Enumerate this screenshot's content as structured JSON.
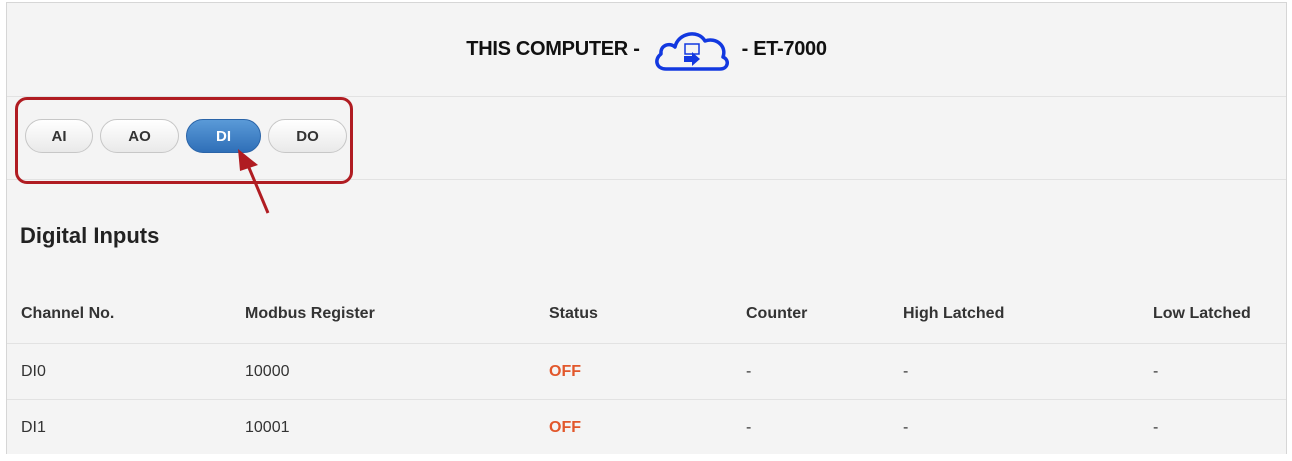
{
  "header": {
    "left_text": "THIS COMPUTER -",
    "right_text": "- ET-7000",
    "icon": "cloud-sync-icon"
  },
  "tabs": [
    {
      "label": "AI",
      "active": false
    },
    {
      "label": "AO",
      "active": false
    },
    {
      "label": "DI",
      "active": true
    },
    {
      "label": "DO",
      "active": false
    }
  ],
  "section": {
    "title": "Digital Inputs"
  },
  "table": {
    "columns": [
      "Channel No.",
      "Modbus Register",
      "Status",
      "Counter",
      "High Latched",
      "Low Latched"
    ],
    "rows": [
      {
        "channel": "DI0",
        "register": "10000",
        "status": "OFF",
        "counter": "-",
        "high": "-",
        "low": "-"
      },
      {
        "channel": "DI1",
        "register": "10001",
        "status": "OFF",
        "counter": "-",
        "high": "-",
        "low": "-"
      }
    ]
  },
  "colors": {
    "active_tab": "#2f6fb8",
    "status_off": "#e2572b",
    "highlight": "#b01c22",
    "cloud": "#1238e0"
  }
}
